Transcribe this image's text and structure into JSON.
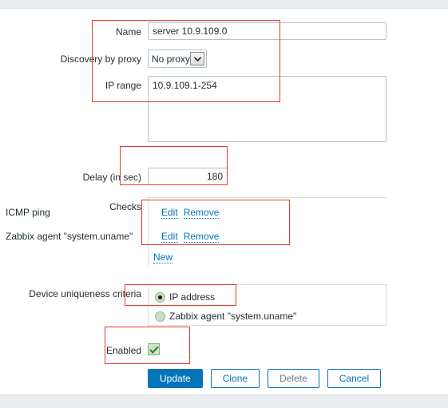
{
  "form": {
    "fields": [
      {
        "label": "Name",
        "value": "server 10.9.109.0"
      },
      {
        "label": "Discovery by proxy",
        "value": "No proxy"
      },
      {
        "label": "IP range",
        "value": "10.9.109.1-254"
      },
      {
        "label": "Delay (in sec)",
        "value": "180"
      },
      {
        "label": "Checks",
        "value": ""
      },
      {
        "label": "Device uniqueness criteria",
        "value": ""
      },
      {
        "label": "Enabled",
        "value": ""
      }
    ],
    "proxy_select": {
      "selected": "No proxy",
      "arrow_icon": "chevron-down-icon"
    },
    "checks": {
      "items": [
        {
          "name": "ICMP ping",
          "edit_label": "Edit",
          "remove_label": "Remove"
        },
        {
          "name": "Zabbix agent \"system.uname\"",
          "edit_label": "Edit",
          "remove_label": "Remove"
        }
      ],
      "new_label": "New"
    },
    "uniqueness": {
      "options": [
        {
          "label": "IP address",
          "selected": true
        },
        {
          "label": "Zabbix agent \"system.uname\"",
          "selected": false
        }
      ]
    },
    "enabled": {
      "checked": true,
      "check_icon": "check-mark-icon"
    }
  },
  "buttons": {
    "update": "Update",
    "clone": "Clone",
    "delete": "Delete",
    "cancel": "Cancel"
  },
  "colors": {
    "accent": "#0275b8",
    "annotation": "#e8382f",
    "field_border": "#b4c3cc",
    "chrome_bar": "#ebeef0",
    "control_fill": "#c9e0c0"
  }
}
